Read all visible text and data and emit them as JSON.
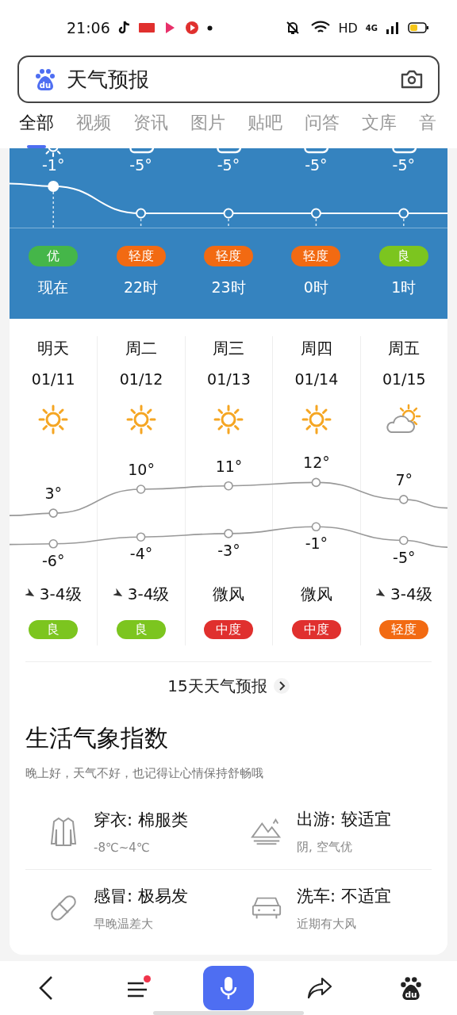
{
  "status_bar": {
    "time": "21:06",
    "hd": "HD",
    "network": "4G"
  },
  "search": {
    "logo_text": "du",
    "value": "天气预报"
  },
  "tabs": [
    {
      "label": "全部",
      "selected": true
    },
    {
      "label": "视频",
      "selected": false
    },
    {
      "label": "资讯",
      "selected": false
    },
    {
      "label": "图片",
      "selected": false
    },
    {
      "label": "贴吧",
      "selected": false
    },
    {
      "label": "问答",
      "selected": false
    },
    {
      "label": "文库",
      "selected": false
    },
    {
      "label": "音",
      "selected": false
    }
  ],
  "hourly": [
    {
      "kind": "sunny",
      "temp": "-1°",
      "aqi": "优",
      "color": "#45b649",
      "time": "现在",
      "current": true
    },
    {
      "kind": "cloudy",
      "temp": "-5°",
      "aqi": "轻度",
      "color": "#f26a12",
      "time": "22时",
      "current": false
    },
    {
      "kind": "cloudy",
      "temp": "-5°",
      "aqi": "轻度",
      "color": "#f26a12",
      "time": "23时",
      "current": false
    },
    {
      "kind": "cloudy",
      "temp": "-5°",
      "aqi": "轻度",
      "color": "#f26a12",
      "time": "0时",
      "current": false
    },
    {
      "kind": "cloudy",
      "temp": "-5°",
      "aqi": "良",
      "color": "#7cc51f",
      "time": "1时",
      "current": false
    }
  ],
  "daily": [
    {
      "day": "明天",
      "date": "01/11",
      "kind": "sunny",
      "high": "3°",
      "low": "-6°",
      "wind": "3-4级",
      "wind_arrow": true,
      "aqi": "良",
      "color": "#7cc51f"
    },
    {
      "day": "周二",
      "date": "01/12",
      "kind": "sunny",
      "high": "10°",
      "low": "-4°",
      "wind": "3-4级",
      "wind_arrow": true,
      "aqi": "良",
      "color": "#7cc51f"
    },
    {
      "day": "周三",
      "date": "01/13",
      "kind": "sunny",
      "high": "11°",
      "low": "-3°",
      "wind": "微风",
      "wind_arrow": false,
      "aqi": "中度",
      "color": "#e0302e"
    },
    {
      "day": "周四",
      "date": "01/14",
      "kind": "sunny",
      "high": "12°",
      "low": "-1°",
      "wind": "微风",
      "wind_arrow": false,
      "aqi": "中度",
      "color": "#e0302e"
    },
    {
      "day": "周五",
      "date": "01/15",
      "kind": "partly_cloudy",
      "high": "7°",
      "low": "-5°",
      "wind": "3-4级",
      "wind_arrow": true,
      "aqi": "轻度",
      "color": "#f26a12"
    }
  ],
  "forecast_link": "15天天气预报",
  "life_index": {
    "title": "生活气象指数",
    "subtitle": "晚上好，天气不好，也记得让心情保持舒畅哦",
    "items": [
      {
        "kind": "clothing",
        "title": "穿衣: 棉服类",
        "detail": "-8℃~4℃"
      },
      {
        "kind": "travel",
        "title": "出游: 较适宜",
        "detail": "阴, 空气优"
      },
      {
        "kind": "cold",
        "title": "感冒: 极易发",
        "detail": "早晚温差大"
      },
      {
        "kind": "carwash",
        "title": "洗车: 不适宜",
        "detail": "近期有大风"
      }
    ]
  },
  "bottom_nav": {
    "menu_badge": true,
    "logo_text": "du"
  }
}
